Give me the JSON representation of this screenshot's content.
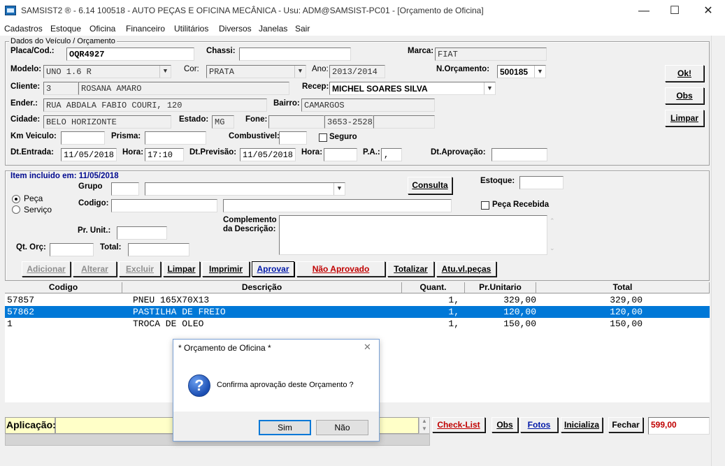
{
  "window": {
    "title": "SAMSIST2 ® - 6.14  100518 - AUTO PEÇAS E OFICINA MECÂNICA - Usu: ADM@SAMSIST-PC01 - [Orçamento de Oficina]",
    "minimize": "—",
    "maximize": "☐",
    "close": "✕"
  },
  "menu": [
    "Cadastros",
    "Estoque",
    "Oficina",
    "Financeiro",
    "Utilitários",
    "Diversos",
    "Janelas",
    "Sair"
  ],
  "vehicle": {
    "group_title": "Dados do Veículo / Orçamento",
    "placa_label": "Placa/Cod.:",
    "placa": "OQR4927",
    "chassi_label": "Chassi:",
    "chassi": "",
    "marca_label": "Marca:",
    "marca": "FIAT",
    "modelo_label": "Modelo:",
    "modelo": "UNO 1.6 R",
    "cor_label": "Cor:",
    "cor": "PRATA",
    "ano_label": "Ano:",
    "ano": "2013/2014",
    "norc_label": "N.Orçamento:",
    "norc": "500185",
    "cliente_label": "Cliente:",
    "cliente_cod": "3",
    "cliente_nome": "ROSANA AMARO",
    "recep_label": "Recep:",
    "recep": "MICHEL SOARES SILVA",
    "ender_label": "Ender.:",
    "ender": "RUA ABDALA FABIO COURI, 120",
    "bairro_label": "Bairro:",
    "bairro": "CAMARGOS",
    "cidade_label": "Cidade:",
    "cidade": "BELO HORIZONTE",
    "estado_label": "Estado:",
    "estado": "MG",
    "fone_label": "Fone:",
    "fone1": "",
    "fone2": "3653-2528",
    "fone3": "",
    "km_label": "Km Veiculo:",
    "km": "",
    "prisma_label": "Prisma:",
    "prisma": "",
    "comb_label": "Combustivel:",
    "comb": "",
    "seguro_label": "Seguro",
    "dtentrada_label": "Dt.Entrada:",
    "dtentrada": "11/05/2018",
    "hora_label": "Hora:",
    "hora": "17:10",
    "dtprev_label": "Dt.Previsão:",
    "dtprev": "11/05/2018",
    "hora2_label": "Hora:",
    "hora2": "",
    "pa_label": "P.A.:",
    "pa": ",",
    "dtaprov_label": "Dt.Aprovação:",
    "dtaprov": ""
  },
  "side_buttons": {
    "ok": "Ok!",
    "obs": "Obs",
    "limpar": "Limpar"
  },
  "item": {
    "title": "Item incluido em: 11/05/2018",
    "peca_label": "Peça",
    "servico_label": "Serviço",
    "grupo_label": "Grupo",
    "grupo_cod": "",
    "grupo_nome": "",
    "consulta": "Consulta",
    "estoque_label": "Estoque:",
    "estoque": "",
    "codigo_label": "Codigo:",
    "codigo": "",
    "codigo_desc": "",
    "peca_recebida_label": "Peça Recebida",
    "prunit_label": "Pr. Unit.:",
    "prunit": "",
    "complemento_label_1": "Complemento",
    "complemento_label_2": "da Descrição:",
    "qtorc_label": "Qt. Orç:",
    "qtorc": "",
    "total_label": "Total:",
    "total": ""
  },
  "action_buttons": [
    "Adicionar",
    "Alterar",
    "Excluir",
    "Limpar",
    "Imprimir",
    "Aprovar",
    "Não Aprovado",
    "Totalizar",
    "Atu.vl.peças"
  ],
  "grid": {
    "headers": [
      "Codigo",
      "Descrição",
      "Quant.",
      "Pr.Unitario",
      "Total"
    ],
    "rows": [
      {
        "codigo": "57857",
        "descricao": "PNEU 165X70X13",
        "quant": "1,",
        "prunit": "329,00",
        "total": "329,00"
      },
      {
        "codigo": "57862",
        "descricao": "PASTILHA DE FREIO",
        "quant": "1,",
        "prunit": "120,00",
        "total": "120,00"
      },
      {
        "codigo": "1",
        "descricao": "TROCA DE OLEO",
        "quant": "1,",
        "prunit": "150,00",
        "total": "150,00"
      }
    ]
  },
  "bottom": {
    "aplicacao_label": "Aplicação:",
    "aplicacao": "",
    "checklist": "Check-List",
    "obs": "Obs",
    "fotos": "Fotos",
    "inicializa": "Inicializa",
    "fechar": "Fechar",
    "grand_total": "599,00"
  },
  "dialog": {
    "title": "* Orçamento de Oficina *",
    "close": "✕",
    "message": "Confirma aprovação deste Orçamento ?",
    "icon": "?",
    "yes": "Sim",
    "no": "Não"
  },
  "colors": {
    "selection": "#0078d7",
    "item_title": "#000a8f",
    "aplicacao_bg": "#ffffc8",
    "total_red": "#c00000"
  }
}
